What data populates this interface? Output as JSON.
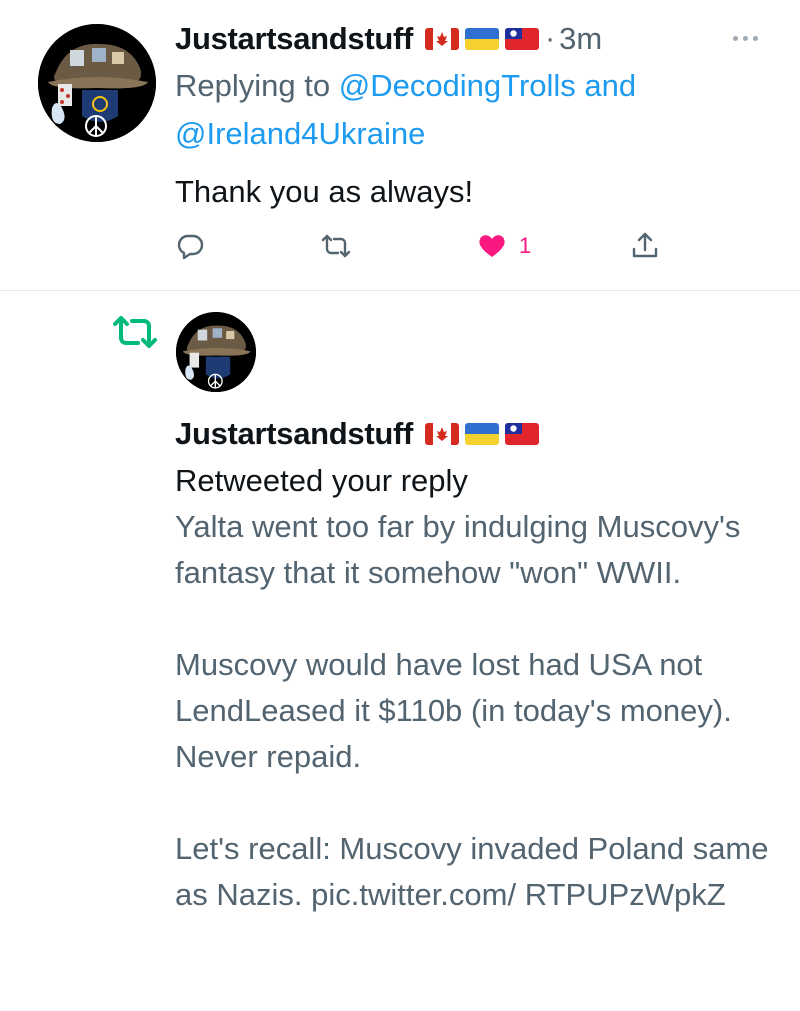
{
  "tweet": {
    "display_name": "Justartsandstuff",
    "flags": [
      "canada-flag",
      "ukraine-flag",
      "taiwan-flag"
    ],
    "separator": "·",
    "time": "3m",
    "replying_prefix": "Replying to",
    "mention_1": "@DecodingTrolls",
    "and_word": "and",
    "mention_2": "@Ireland4Ukraine",
    "text": "Thank you as always!",
    "actions": {
      "reply_icon": "reply-icon",
      "retweet_icon": "retweet-icon",
      "like_icon": "heart-icon",
      "like_count": "1",
      "share_icon": "share-icon"
    }
  },
  "notification": {
    "icon": "retweet-icon",
    "display_name": "Justartsandstuff",
    "flags": [
      "canada-flag",
      "ukraine-flag",
      "taiwan-flag"
    ],
    "action_text": "Retweeted your reply",
    "quoted_paragraphs": [
      "Yalta went too far by indulging Muscovy's fantasy that it somehow \"won\" WWII.",
      "Muscovy would have lost had USA not LendLeased it $110b (in today's money). Never repaid.",
      "Let's recall: Muscovy invaded Poland same as Nazis. pic.twitter.com/ RTPUPzWpkZ"
    ]
  },
  "colors": {
    "text_primary": "#0f1419",
    "text_secondary": "#536471",
    "link": "#1d9bf0",
    "like": "#f91880",
    "retweet": "#00ba7c",
    "divider": "#e6e9ec"
  }
}
